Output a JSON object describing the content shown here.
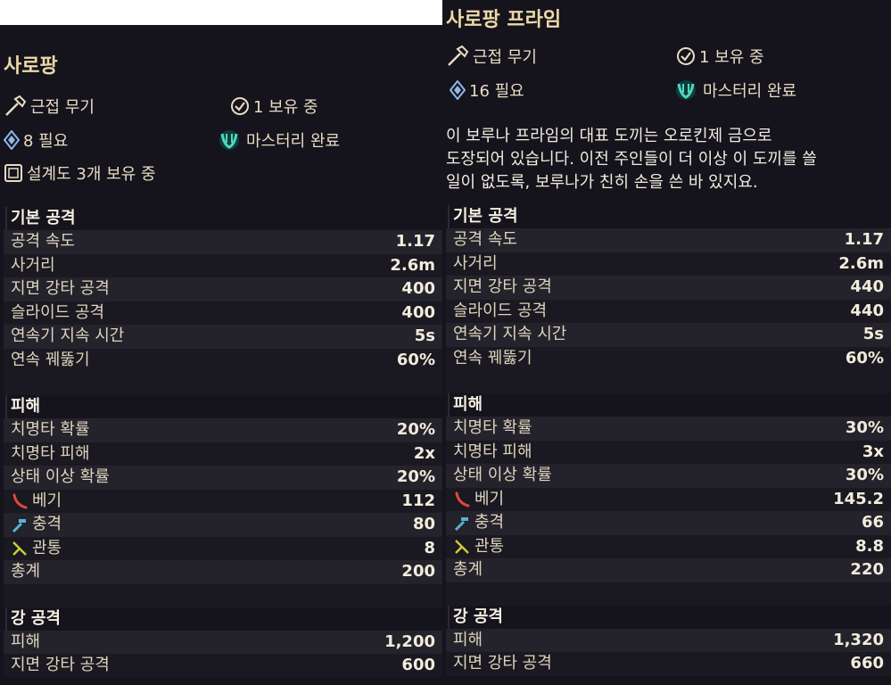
{
  "left": {
    "title": "사로팡",
    "weapon_type": "근접 무기",
    "owned": "1 보유 중",
    "mastery_req": "8 필요",
    "mastery_status": "마스터리 완료",
    "blueprint": "설계도 3개 보유 중",
    "sections": [
      {
        "title": "기본 공격",
        "rows": [
          {
            "label": "공격 속도",
            "value": "1.17"
          },
          {
            "label": "사거리",
            "value": "2.6m"
          },
          {
            "label": "지면 강타 공격",
            "value": "400"
          },
          {
            "label": "슬라이드 공격",
            "value": "400"
          },
          {
            "label": "연속기 지속 시간",
            "value": "5s"
          },
          {
            "label": "연속 꿰뚫기",
            "value": "60%"
          }
        ]
      },
      {
        "title": "피해",
        "rows": [
          {
            "label": "치명타 확률",
            "value": "20%"
          },
          {
            "label": "치명타 피해",
            "value": "2x"
          },
          {
            "label": "상태 이상 확률",
            "value": "20%"
          },
          {
            "label": "베기",
            "value": "112",
            "icon": "slash-icon"
          },
          {
            "label": "충격",
            "value": "80",
            "icon": "impact-icon"
          },
          {
            "label": "관통",
            "value": "8",
            "icon": "puncture-icon"
          },
          {
            "label": "총계",
            "value": "200"
          }
        ]
      },
      {
        "title": "강 공격",
        "rows": [
          {
            "label": "피해",
            "value": "1,200"
          },
          {
            "label": "지면 강타 공격",
            "value": "600"
          }
        ]
      }
    ]
  },
  "right": {
    "title": "사로팡 프라임",
    "weapon_type": "근접 무기",
    "owned": "1 보유 중",
    "mastery_req": "16 필요",
    "mastery_status": "마스터리 완료",
    "description": "이 보루나 프라임의 대표 도끼는 오로킨제 금으로\n도장되어 있습니다. 이전 주인들이 더 이상 이 도끼를 쓸\n일이 없도록, 보루나가 친히 손을 쓴 바 있지요.",
    "sections": [
      {
        "title": "기본 공격",
        "rows": [
          {
            "label": "공격 속도",
            "value": "1.17"
          },
          {
            "label": "사거리",
            "value": "2.6m"
          },
          {
            "label": "지면 강타 공격",
            "value": "440"
          },
          {
            "label": "슬라이드 공격",
            "value": "440"
          },
          {
            "label": "연속기 지속 시간",
            "value": "5s"
          },
          {
            "label": "연속 꿰뚫기",
            "value": "60%"
          }
        ]
      },
      {
        "title": "피해",
        "rows": [
          {
            "label": "치명타 확률",
            "value": "30%"
          },
          {
            "label": "치명타 피해",
            "value": "3x"
          },
          {
            "label": "상태 이상 확률",
            "value": "30%"
          },
          {
            "label": "베기",
            "value": "145.2",
            "icon": "slash-icon"
          },
          {
            "label": "충격",
            "value": "66",
            "icon": "impact-icon"
          },
          {
            "label": "관통",
            "value": "8.8",
            "icon": "puncture-icon"
          },
          {
            "label": "총계",
            "value": "220"
          }
        ]
      },
      {
        "title": "강 공격",
        "rows": [
          {
            "label": "피해",
            "value": "1,320"
          },
          {
            "label": "지면 강타 공격",
            "value": "660"
          }
        ]
      }
    ]
  },
  "colors": {
    "background": "#15131b",
    "title": "#ecd8a8",
    "slash": "#e0473d",
    "impact": "#56b3d6",
    "puncture": "#c9cc3c",
    "mastery": "#4fd6c3"
  }
}
